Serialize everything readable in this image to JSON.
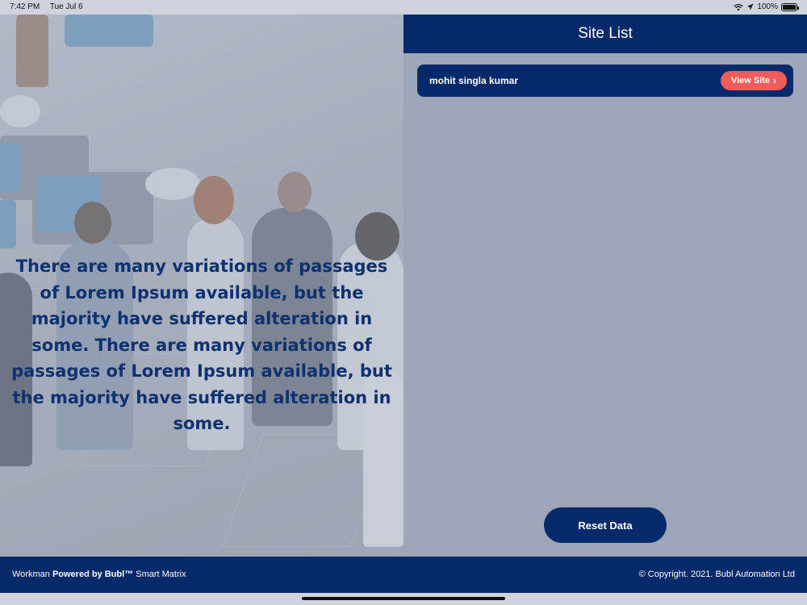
{
  "status_bar": {
    "time": "7:42 PM",
    "date": "Tue Jul 6",
    "battery": "100%",
    "icons": [
      "wifi-icon",
      "location-icon",
      "battery-icon"
    ]
  },
  "hero": {
    "text": "There are many variations of passages of Lorem Ipsum available, but the majority have suffered alteration in some. There are many variations of passages of Lorem Ipsum available, but the majority have suffered alteration in some."
  },
  "panel": {
    "title": "Site List",
    "sites": [
      {
        "name": "mohit singla kumar",
        "action_label": "View Site"
      }
    ],
    "reset_label": "Reset Data"
  },
  "footer": {
    "brand": "Workman",
    "powered_by": "Powered by Bubl™",
    "product": "Smart Matrix",
    "copyright": "© Copyright. 2021.  Bubl Automation Ltd"
  },
  "colors": {
    "navy": "#042a69",
    "accent": "#ef5c5a",
    "panel_bg": "#9da5b8",
    "hero_text": "#0e3170"
  }
}
